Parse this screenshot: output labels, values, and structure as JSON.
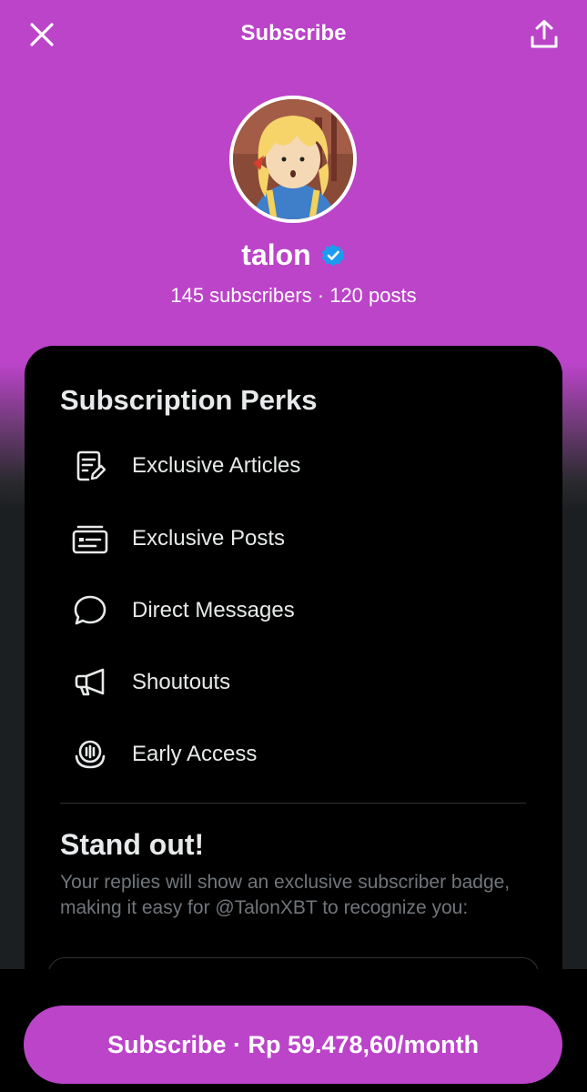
{
  "header": {
    "title": "Subscribe",
    "close_icon": "close-icon",
    "share_icon": "share-icon"
  },
  "profile": {
    "username": "talon",
    "stats": "145 subscribers · 120 posts",
    "verified_color": "#1d9bf0"
  },
  "perks": {
    "title": "Subscription Perks",
    "items": [
      {
        "label": "Exclusive Articles",
        "icon": "article-icon"
      },
      {
        "label": "Exclusive Posts",
        "icon": "posts-icon"
      },
      {
        "label": "Direct Messages",
        "icon": "message-icon"
      },
      {
        "label": "Shoutouts",
        "icon": "megaphone-icon"
      },
      {
        "label": "Early Access",
        "icon": "early-access-icon"
      }
    ]
  },
  "standout": {
    "title": "Stand out!",
    "description": "Your replies will show an exclusive subscriber badge, making it easy for @TalonXBT to recognize you:"
  },
  "cta": {
    "label": "Subscribe · Rp 59.478,60/month"
  },
  "colors": {
    "accent": "#bb44c9",
    "card_bg": "#000000",
    "text_primary": "#e7e9ea",
    "text_secondary": "#71767b"
  }
}
